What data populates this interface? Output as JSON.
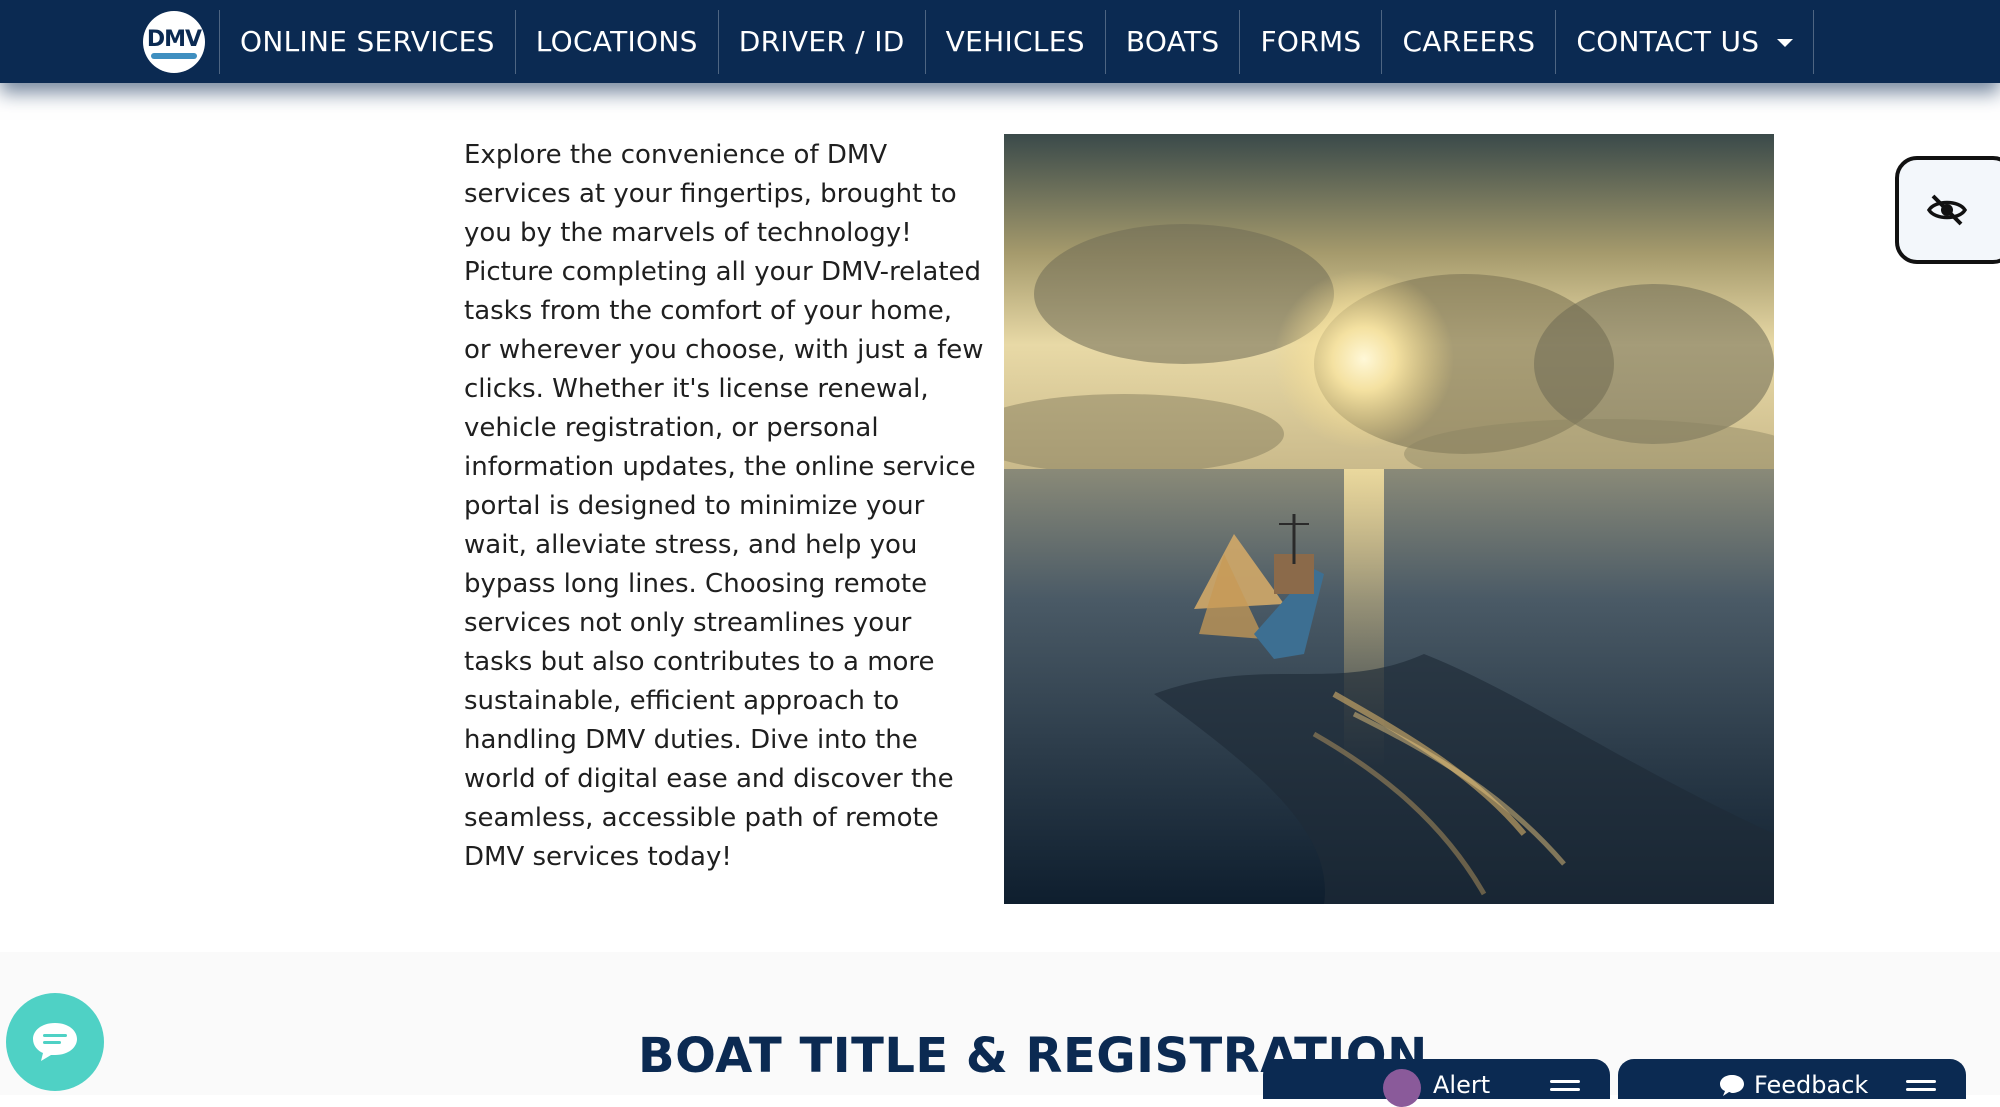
{
  "header": {
    "logo_text": "DMV",
    "nav_items": [
      {
        "label": "ONLINE SERVICES"
      },
      {
        "label": "LOCATIONS"
      },
      {
        "label": "DRIVER / ID"
      },
      {
        "label": "VEHICLES"
      },
      {
        "label": "BOATS"
      },
      {
        "label": "FORMS"
      },
      {
        "label": "CAREERS"
      },
      {
        "label": "CONTACT US",
        "has_dropdown": true
      }
    ]
  },
  "intro": {
    "text": "Explore the convenience of DMV services at your fingertips, brought to you by the marvels of technology! Picture completing all your DMV-related tasks from the comfort of your home, or wherever you choose, with just a few clicks. Whether it's license renewal, vehicle registration, or personal information updates, the online service portal is designed to minimize your wait, alleviate stress, and help you bypass long lines. Choosing remote services not only streamlines your tasks but also contributes to a more sustainable, efficient approach to handling DMV duties. Dive into the world of digital ease and discover the seamless, accessible path of remote DMV services today!"
  },
  "section": {
    "title": "BOAT TITLE & REGISTRATION"
  },
  "widgets": {
    "alert_label": "Alert",
    "feedback_label": "Feedback",
    "accessibility_icon": "eye-slash-icon",
    "chat_icon": "chat-bubble-icon"
  },
  "colors": {
    "navy": "#0b2a52",
    "chat_teal": "#4fd1c5"
  }
}
